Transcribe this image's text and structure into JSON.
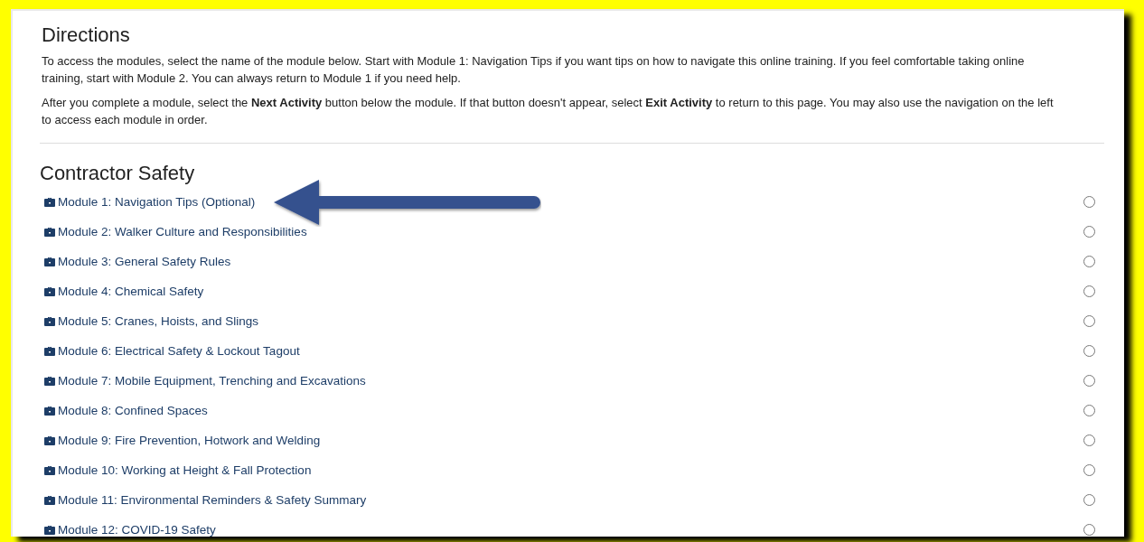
{
  "directions": {
    "title": "Directions",
    "paragraphs": [
      "To access the modules, select the name of the module below. Start with Module 1: Navigation Tips if you want tips on how to navigate this online training. If you feel comfortable taking online training, start with Module 2. You can always return to Module 1 if you need help.",
      "After you complete a module, select the **Next Activity** button below the module. If that button doesn't appear, select **Exit Activity** to return to this page. You may also use the navigation on the left to access each module in order."
    ]
  },
  "section": {
    "title": "Contractor Safety",
    "modules": [
      {
        "label": "Module 1: Navigation Tips (Optional)",
        "checked": false,
        "highlighted": true
      },
      {
        "label": "Module 2: Walker Culture and Responsibilities",
        "checked": false,
        "highlighted": false
      },
      {
        "label": "Module 3: General Safety Rules",
        "checked": false,
        "highlighted": false
      },
      {
        "label": "Module 4: Chemical Safety",
        "checked": false,
        "highlighted": false
      },
      {
        "label": "Module 5: Cranes, Hoists, and Slings",
        "checked": false,
        "highlighted": false
      },
      {
        "label": "Module 6: Electrical Safety & Lockout Tagout",
        "checked": false,
        "highlighted": false
      },
      {
        "label": "Module 7: Mobile Equipment, Trenching and Excavations",
        "checked": false,
        "highlighted": false
      },
      {
        "label": "Module 8: Confined Spaces",
        "checked": false,
        "highlighted": false
      },
      {
        "label": "Module 9: Fire Prevention, Hotwork and Welding",
        "checked": false,
        "highlighted": false
      },
      {
        "label": "Module 10: Working at Height & Fall Protection",
        "checked": false,
        "highlighted": false
      },
      {
        "label": "Module 11: Environmental Reminders & Safety Summary",
        "checked": false,
        "highlighted": false
      },
      {
        "label": "Module 12: COVID-19 Safety",
        "checked": false,
        "highlighted": false
      }
    ]
  }
}
